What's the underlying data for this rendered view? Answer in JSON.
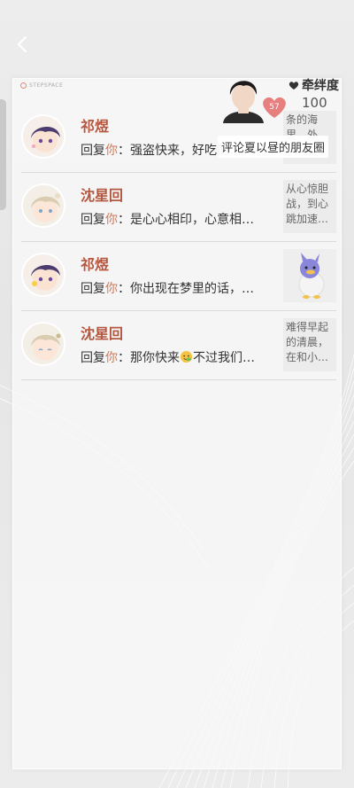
{
  "header": {
    "back_icon": "chevron-left-icon",
    "brand": "STEPSPACE"
  },
  "bond": {
    "title": "牵绊度",
    "value": "100",
    "badge_level": "57"
  },
  "tooltip": {
    "text": "评论夏以昼的朋友圈"
  },
  "messages": [
    {
      "name": "祁煜",
      "reply_prefix": "回复",
      "you": "你",
      "text": "：强盗快来，好吃的…",
      "thumb_text": "条的海\n里，外"
    },
    {
      "name": "沈星回",
      "reply_prefix": "回复",
      "you": "你",
      "text": "：是心心相印，心意相…",
      "thumb_text": "从心惊胆战，到心跳加速…"
    },
    {
      "name": "祁煜",
      "reply_prefix": "回复",
      "you": "你",
      "text": "：你出现在梦里的话，…",
      "thumb_text": ""
    },
    {
      "name": "沈星回",
      "reply_prefix": "回复",
      "you": "你",
      "text_a": "：那你快来",
      "text_b": "不过我们…",
      "thumb_text": "难得早起的清晨，在和小…"
    }
  ],
  "colors": {
    "name": "#b5563e",
    "you": "#d07a5a",
    "heart": "#e46a6a"
  }
}
